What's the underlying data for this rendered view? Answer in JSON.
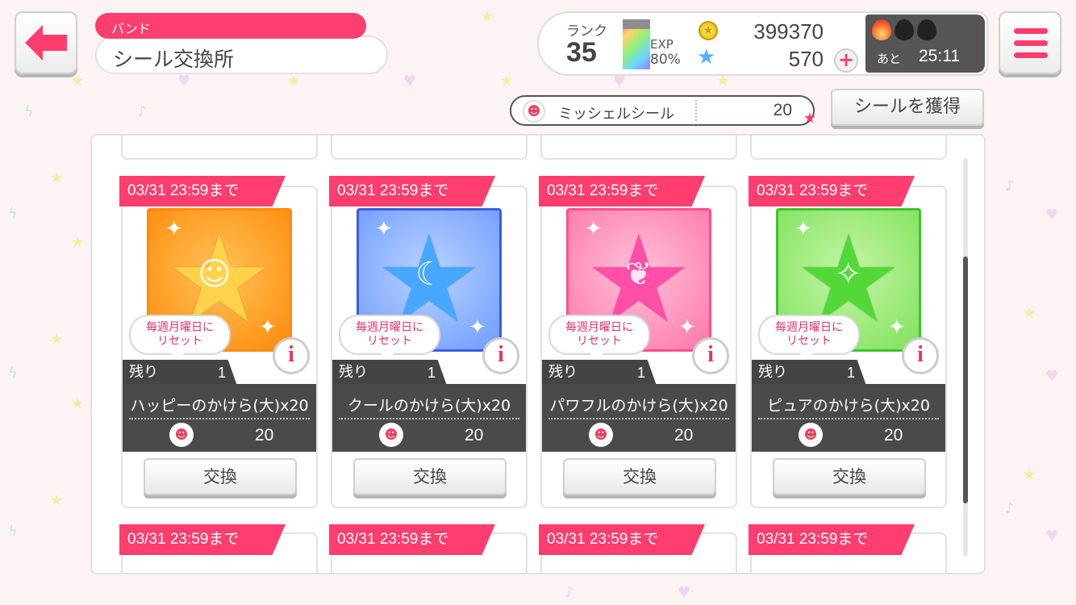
{
  "header": {
    "category": "バンド",
    "title": "シール交換所"
  },
  "status": {
    "rank_label": "ランク",
    "rank": "35",
    "exp_label": "EXP",
    "exp_percent": "80%",
    "coins": "399370",
    "stars": "570",
    "live_boost_label": "あと",
    "live_boost_timer": "25:11"
  },
  "seal_counter": {
    "name": "ミッシェルシール",
    "count": "20"
  },
  "get_seal_label": "シールを獲得",
  "colors": {
    "accent": "#ff3d6e",
    "dark": "#4a4a4a",
    "orange": "#ff9a1e",
    "blue": "#3a5de0",
    "pink": "#ff4e8f",
    "green": "#3fc231"
  },
  "cards": [
    {
      "deadline": "03/31 23:59まで",
      "reset": "毎週月曜日に\nリセット",
      "remain_label": "残り",
      "remain": "1",
      "name": "ハッピーのかけら(大)x20",
      "cost": "20",
      "button": "交換"
    },
    {
      "deadline": "03/31 23:59まで",
      "reset": "毎週月曜日に\nリセット",
      "remain_label": "残り",
      "remain": "1",
      "name": "クールのかけら(大)x20",
      "cost": "20",
      "button": "交換"
    },
    {
      "deadline": "03/31 23:59まで",
      "reset": "毎週月曜日に\nリセット",
      "remain_label": "残り",
      "remain": "1",
      "name": "パワフルのかけら(大)x20",
      "cost": "20",
      "button": "交換"
    },
    {
      "deadline": "03/31 23:59まで",
      "reset": "毎週月曜日に\nリセット",
      "remain_label": "残り",
      "remain": "1",
      "name": "ピュアのかけら(大)x20",
      "cost": "20",
      "button": "交換"
    }
  ],
  "next_row_deadlines": [
    "03/31 23:59まで",
    "03/31 23:59まで",
    "03/31 23:59まで",
    "03/31 23:59まで"
  ]
}
